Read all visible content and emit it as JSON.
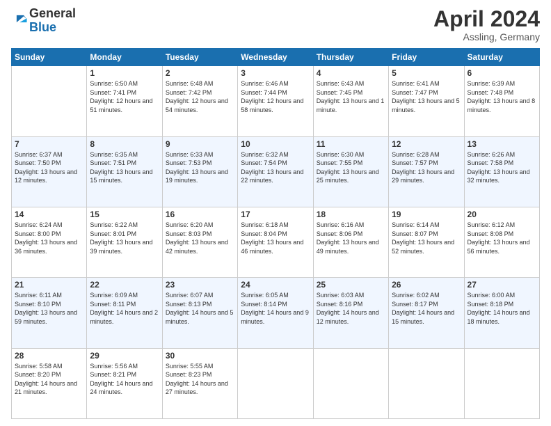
{
  "header": {
    "logo_general": "General",
    "logo_blue": "Blue",
    "month": "April 2024",
    "location": "Assling, Germany"
  },
  "days_of_week": [
    "Sunday",
    "Monday",
    "Tuesday",
    "Wednesday",
    "Thursday",
    "Friday",
    "Saturday"
  ],
  "weeks": [
    [
      {
        "day": "",
        "sunrise": "",
        "sunset": "",
        "daylight": ""
      },
      {
        "day": "1",
        "sunrise": "Sunrise: 6:50 AM",
        "sunset": "Sunset: 7:41 PM",
        "daylight": "Daylight: 12 hours and 51 minutes."
      },
      {
        "day": "2",
        "sunrise": "Sunrise: 6:48 AM",
        "sunset": "Sunset: 7:42 PM",
        "daylight": "Daylight: 12 hours and 54 minutes."
      },
      {
        "day": "3",
        "sunrise": "Sunrise: 6:46 AM",
        "sunset": "Sunset: 7:44 PM",
        "daylight": "Daylight: 12 hours and 58 minutes."
      },
      {
        "day": "4",
        "sunrise": "Sunrise: 6:43 AM",
        "sunset": "Sunset: 7:45 PM",
        "daylight": "Daylight: 13 hours and 1 minute."
      },
      {
        "day": "5",
        "sunrise": "Sunrise: 6:41 AM",
        "sunset": "Sunset: 7:47 PM",
        "daylight": "Daylight: 13 hours and 5 minutes."
      },
      {
        "day": "6",
        "sunrise": "Sunrise: 6:39 AM",
        "sunset": "Sunset: 7:48 PM",
        "daylight": "Daylight: 13 hours and 8 minutes."
      }
    ],
    [
      {
        "day": "7",
        "sunrise": "Sunrise: 6:37 AM",
        "sunset": "Sunset: 7:50 PM",
        "daylight": "Daylight: 13 hours and 12 minutes."
      },
      {
        "day": "8",
        "sunrise": "Sunrise: 6:35 AM",
        "sunset": "Sunset: 7:51 PM",
        "daylight": "Daylight: 13 hours and 15 minutes."
      },
      {
        "day": "9",
        "sunrise": "Sunrise: 6:33 AM",
        "sunset": "Sunset: 7:53 PM",
        "daylight": "Daylight: 13 hours and 19 minutes."
      },
      {
        "day": "10",
        "sunrise": "Sunrise: 6:32 AM",
        "sunset": "Sunset: 7:54 PM",
        "daylight": "Daylight: 13 hours and 22 minutes."
      },
      {
        "day": "11",
        "sunrise": "Sunrise: 6:30 AM",
        "sunset": "Sunset: 7:55 PM",
        "daylight": "Daylight: 13 hours and 25 minutes."
      },
      {
        "day": "12",
        "sunrise": "Sunrise: 6:28 AM",
        "sunset": "Sunset: 7:57 PM",
        "daylight": "Daylight: 13 hours and 29 minutes."
      },
      {
        "day": "13",
        "sunrise": "Sunrise: 6:26 AM",
        "sunset": "Sunset: 7:58 PM",
        "daylight": "Daylight: 13 hours and 32 minutes."
      }
    ],
    [
      {
        "day": "14",
        "sunrise": "Sunrise: 6:24 AM",
        "sunset": "Sunset: 8:00 PM",
        "daylight": "Daylight: 13 hours and 36 minutes."
      },
      {
        "day": "15",
        "sunrise": "Sunrise: 6:22 AM",
        "sunset": "Sunset: 8:01 PM",
        "daylight": "Daylight: 13 hours and 39 minutes."
      },
      {
        "day": "16",
        "sunrise": "Sunrise: 6:20 AM",
        "sunset": "Sunset: 8:03 PM",
        "daylight": "Daylight: 13 hours and 42 minutes."
      },
      {
        "day": "17",
        "sunrise": "Sunrise: 6:18 AM",
        "sunset": "Sunset: 8:04 PM",
        "daylight": "Daylight: 13 hours and 46 minutes."
      },
      {
        "day": "18",
        "sunrise": "Sunrise: 6:16 AM",
        "sunset": "Sunset: 8:06 PM",
        "daylight": "Daylight: 13 hours and 49 minutes."
      },
      {
        "day": "19",
        "sunrise": "Sunrise: 6:14 AM",
        "sunset": "Sunset: 8:07 PM",
        "daylight": "Daylight: 13 hours and 52 minutes."
      },
      {
        "day": "20",
        "sunrise": "Sunrise: 6:12 AM",
        "sunset": "Sunset: 8:08 PM",
        "daylight": "Daylight: 13 hours and 56 minutes."
      }
    ],
    [
      {
        "day": "21",
        "sunrise": "Sunrise: 6:11 AM",
        "sunset": "Sunset: 8:10 PM",
        "daylight": "Daylight: 13 hours and 59 minutes."
      },
      {
        "day": "22",
        "sunrise": "Sunrise: 6:09 AM",
        "sunset": "Sunset: 8:11 PM",
        "daylight": "Daylight: 14 hours and 2 minutes."
      },
      {
        "day": "23",
        "sunrise": "Sunrise: 6:07 AM",
        "sunset": "Sunset: 8:13 PM",
        "daylight": "Daylight: 14 hours and 5 minutes."
      },
      {
        "day": "24",
        "sunrise": "Sunrise: 6:05 AM",
        "sunset": "Sunset: 8:14 PM",
        "daylight": "Daylight: 14 hours and 9 minutes."
      },
      {
        "day": "25",
        "sunrise": "Sunrise: 6:03 AM",
        "sunset": "Sunset: 8:16 PM",
        "daylight": "Daylight: 14 hours and 12 minutes."
      },
      {
        "day": "26",
        "sunrise": "Sunrise: 6:02 AM",
        "sunset": "Sunset: 8:17 PM",
        "daylight": "Daylight: 14 hours and 15 minutes."
      },
      {
        "day": "27",
        "sunrise": "Sunrise: 6:00 AM",
        "sunset": "Sunset: 8:18 PM",
        "daylight": "Daylight: 14 hours and 18 minutes."
      }
    ],
    [
      {
        "day": "28",
        "sunrise": "Sunrise: 5:58 AM",
        "sunset": "Sunset: 8:20 PM",
        "daylight": "Daylight: 14 hours and 21 minutes."
      },
      {
        "day": "29",
        "sunrise": "Sunrise: 5:56 AM",
        "sunset": "Sunset: 8:21 PM",
        "daylight": "Daylight: 14 hours and 24 minutes."
      },
      {
        "day": "30",
        "sunrise": "Sunrise: 5:55 AM",
        "sunset": "Sunset: 8:23 PM",
        "daylight": "Daylight: 14 hours and 27 minutes."
      },
      {
        "day": "",
        "sunrise": "",
        "sunset": "",
        "daylight": ""
      },
      {
        "day": "",
        "sunrise": "",
        "sunset": "",
        "daylight": ""
      },
      {
        "day": "",
        "sunrise": "",
        "sunset": "",
        "daylight": ""
      },
      {
        "day": "",
        "sunrise": "",
        "sunset": "",
        "daylight": ""
      }
    ]
  ]
}
